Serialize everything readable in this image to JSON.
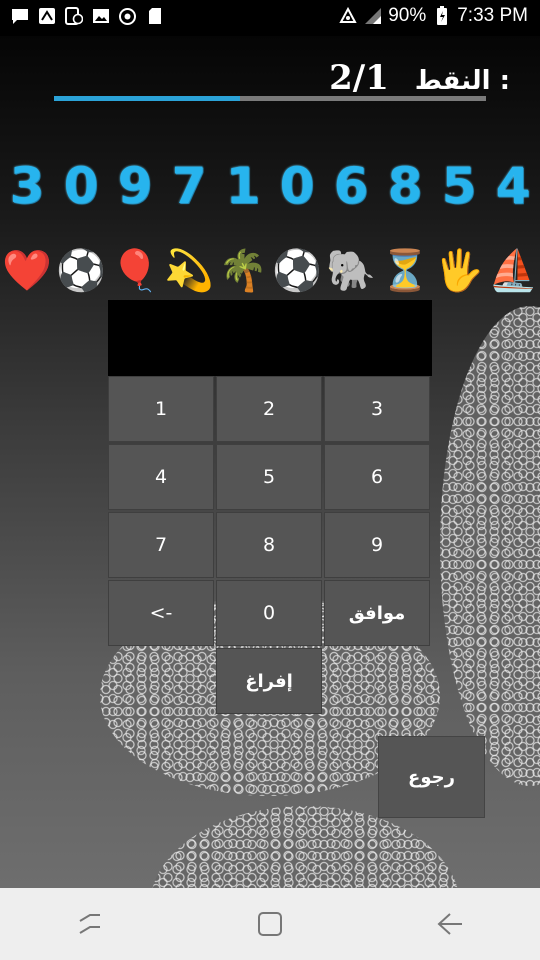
{
  "status_bar": {
    "battery": "90%",
    "time": "7:33 PM",
    "icons": [
      "message-icon",
      "notification-icon",
      "clock-app-icon",
      "image-icon",
      "sync-icon",
      "sd-card-icon"
    ],
    "right_icons": [
      "data-saver-icon",
      "signal-icon",
      "battery-charging-icon"
    ]
  },
  "game": {
    "score_label": "النقط :",
    "score_value": "2/1",
    "progress": 0.43,
    "digits": [
      "3",
      "0",
      "9",
      "7",
      "1",
      "0",
      "6",
      "8",
      "5",
      "4"
    ],
    "emojis": [
      "❤️",
      "⚽",
      "🎈",
      "💫",
      "🌴",
      "⚽",
      "🐘",
      "⏳",
      "🖐️",
      "⛵"
    ],
    "emoji_names": [
      "heart",
      "soccer-ball",
      "balloon",
      "comet",
      "palm-tree",
      "soccer-ball",
      "elephant",
      "hourglass",
      "hand",
      "sailboat"
    ],
    "display_value": ""
  },
  "keypad": {
    "keys": [
      "1",
      "2",
      "3",
      "4",
      "5",
      "6",
      "7",
      "8",
      "9",
      "<-",
      "0",
      "موافق"
    ],
    "clear": "إفراغ",
    "back": "رجوع"
  },
  "nav_bar": {
    "icons": [
      "recent-apps-icon",
      "home-icon",
      "back-icon"
    ]
  },
  "colors": {
    "accent": "#2ba3d8",
    "digit_color": "#27b4ee",
    "key_bg": "#555555"
  }
}
